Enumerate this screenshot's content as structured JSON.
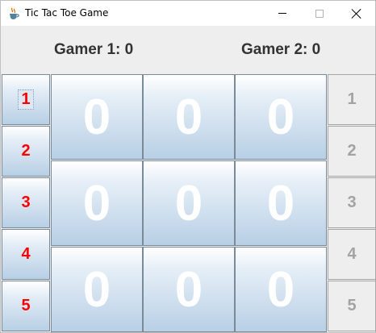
{
  "window": {
    "title": "Tic Tac Toe Game",
    "icon": "java-cup-icon"
  },
  "scores": {
    "gamer1": "Gamer 1: 0",
    "gamer2": "Gamer 2: 0"
  },
  "left_buttons": [
    "1",
    "2",
    "3",
    "4",
    "5"
  ],
  "right_buttons": [
    "1",
    "2",
    "3",
    "4",
    "5"
  ],
  "board": [
    [
      "0",
      "0",
      "0"
    ],
    [
      "0",
      "0",
      "0"
    ],
    [
      "0",
      "0",
      "0"
    ]
  ],
  "colors": {
    "left_button_text": "#ff0000",
    "right_button_text": "#a3a3a3",
    "cell_text": "#ffffff",
    "cell_gradient_top": "#ffffff",
    "cell_gradient_bottom": "#b8cfe5"
  }
}
